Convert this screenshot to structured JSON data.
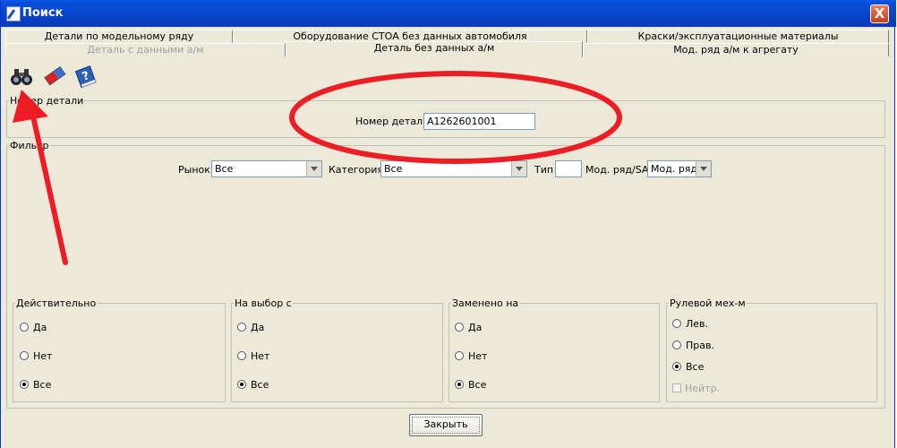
{
  "window": {
    "title": "Поиск",
    "close_label": "X"
  },
  "tabs_row1": [
    {
      "label": "Детали по модельному ряду"
    },
    {
      "label": "Оборудование СТОА без данных автомобиля"
    },
    {
      "label": "Краски/эксплуатационные материалы"
    }
  ],
  "tabs_row2": [
    {
      "label": "Деталь с данными а/м",
      "state": "disabled"
    },
    {
      "label": "Деталь без данных а/м",
      "state": "selected"
    },
    {
      "label": "Мод. ряд а/м к агрегату",
      "state": "normal"
    }
  ],
  "toolbar": [
    {
      "name": "binoculars-icon"
    },
    {
      "name": "eraser-icon"
    },
    {
      "name": "help-book-icon"
    }
  ],
  "part_number_group": {
    "legend": "Номер детали",
    "field_label": "Номер детали",
    "field_value": "A1262601001"
  },
  "filter_group": {
    "legend": "Фильтр",
    "market_label": "Рынок",
    "market_value": "Все",
    "category_label": "Категория",
    "category_value": "Все",
    "type_label": "Тип",
    "type_value": "",
    "model_label": "Мод. ряд/SA",
    "model_value": "Мод. ряд"
  },
  "valid_group": {
    "legend": "Действительно",
    "options": [
      "Да",
      "Нет",
      "Все"
    ],
    "selected": 2
  },
  "choice_group": {
    "legend": "На выбор с",
    "options": [
      "Да",
      "Нет",
      "Все"
    ],
    "selected": 2
  },
  "replaced_group": {
    "legend": "Заменено на",
    "options": [
      "Да",
      "Нет",
      "Все"
    ],
    "selected": 2
  },
  "steering_group": {
    "legend": "Рулевой мех-м",
    "options": [
      "Лев.",
      "Прав.",
      "Все"
    ],
    "selected": 2,
    "check_label": "Нейтр."
  },
  "close_button": {
    "label": "Закрыть"
  },
  "colors": {
    "annotation_red": "#ee1c24",
    "titlebar_blue": "#0842c8"
  }
}
